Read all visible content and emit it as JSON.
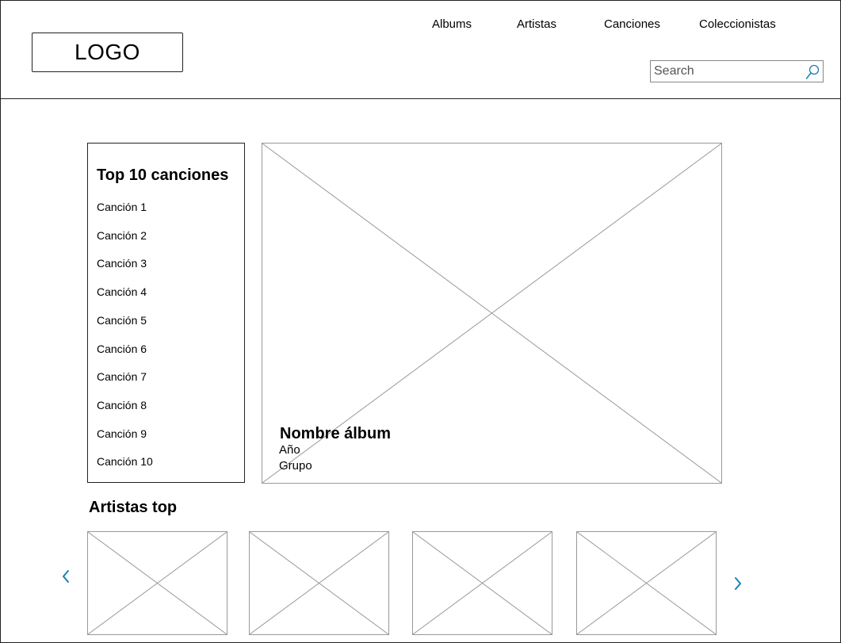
{
  "header": {
    "logo": "LOGO",
    "nav": [
      "Albums",
      "Artistas",
      "Canciones",
      "Coleccionistas"
    ],
    "search_placeholder": "Search",
    "search_icon": "search-icon"
  },
  "top_songs": {
    "title": "Top 10 canciones",
    "items": [
      "Canción 1",
      "Canción 2",
      "Canción 3",
      "Canción 4",
      "Canción 5",
      "Canción 6",
      "Canción 7",
      "Canción 8",
      "Canción 9",
      "Canción 10"
    ]
  },
  "featured_album": {
    "name": "Nombre álbum",
    "year_label": "Año",
    "group_label": "Grupo"
  },
  "top_artists": {
    "title": "Artistas top",
    "prev_icon": "chevron-left-icon",
    "next_icon": "chevron-right-icon",
    "accent_color": "#1a7fb5"
  }
}
